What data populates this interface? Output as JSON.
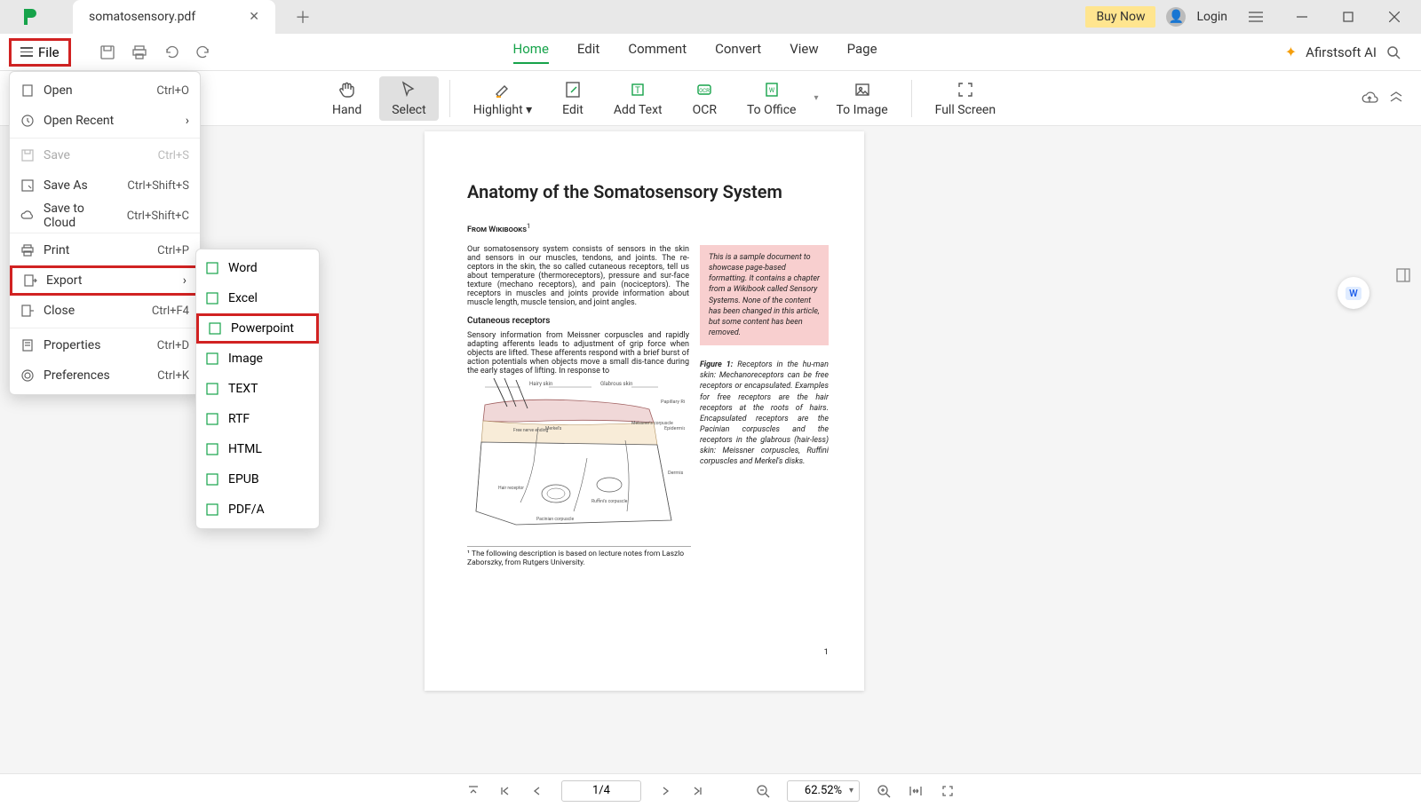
{
  "titlebar": {
    "tab_title": "somatosensory.pdf",
    "buy_now": "Buy Now",
    "login": "Login"
  },
  "menubar": {
    "file": "File",
    "tabs": [
      "Home",
      "Edit",
      "Comment",
      "Convert",
      "View",
      "Page"
    ],
    "ai_label": "Afirstsoft AI"
  },
  "ribbon": {
    "hand": "Hand",
    "select": "Select",
    "highlight": "Highlight",
    "edit": "Edit",
    "addtext": "Add Text",
    "ocr": "OCR",
    "tooffice": "To Office",
    "toimage": "To Image",
    "fullscreen": "Full Screen"
  },
  "file_menu": {
    "open": {
      "label": "Open",
      "sc": "Ctrl+O"
    },
    "open_recent": {
      "label": "Open Recent"
    },
    "save": {
      "label": "Save",
      "sc": "Ctrl+S"
    },
    "save_as": {
      "label": "Save As",
      "sc": "Ctrl+Shift+S"
    },
    "save_cloud": {
      "label": "Save to Cloud",
      "sc": "Ctrl+Shift+C"
    },
    "print": {
      "label": "Print",
      "sc": "Ctrl+P"
    },
    "export": {
      "label": "Export"
    },
    "close": {
      "label": "Close",
      "sc": "Ctrl+F4"
    },
    "properties": {
      "label": "Properties",
      "sc": "Ctrl+D"
    },
    "preferences": {
      "label": "Preferences",
      "sc": "Ctrl+K"
    }
  },
  "export_menu": {
    "word": "Word",
    "excel": "Excel",
    "powerpoint": "Powerpoint",
    "image": "Image",
    "text": "TEXT",
    "rtf": "RTF",
    "html": "HTML",
    "epub": "EPUB",
    "pdfa": "PDF/A"
  },
  "doc": {
    "title": "Anatomy of the Somatosensory System",
    "from": "From Wikibooks",
    "para1": "Our somatosensory system consists of sensors in the skin and sensors in our muscles, tendons, and joints. The re-ceptors in the skin, the so called cutaneous receptors, tell us about temperature (thermoreceptors), pressure and sur-face texture (mechano receptors), and pain (nociceptors). The receptors in muscles and joints provide information about muscle length, muscle tension, and joint angles.",
    "sample": "This is a sample document to showcase page-based formatting. It contains a chapter from a Wikibook called Sensory Systems. None of the content has been changed in this article, but some content has been removed.",
    "sub1": "Cutaneous receptors",
    "para2": "Sensory information from Meissner corpuscles and rapidly adapting afferents leads to adjustment of grip force when objects are lifted. These afferents respond with a brief burst of action potentials when objects move a small dis-tance during the early stages of lifting. In response to",
    "figcap_b": "Figure 1:",
    "figcap": " Receptors in the hu-man skin: Mechanoreceptors can be free receptors or encapsulated. Examples for free receptors are the hair receptors at the roots of hairs. Encapsulated receptors are the Pacinian corpuscles and the receptors in the glabrous (hair-less) skin: Meissner corpuscles, Ruffini corpuscles and Merkel's disks.",
    "footnote": "¹ The following description is based on lecture notes from Laszlo Zaborszky, from Rutgers University.",
    "pagenum": "1",
    "fig_labels": {
      "hairy": "Hairy skin",
      "glabrous": "Glabrous skin",
      "papillary": "Papillary Ridges",
      "epidermis": "Epidermis",
      "dermis": "Dermis",
      "meissner": "Meissner's corpuscle",
      "merkel": "Merkel's disc",
      "freenerve": "Free nerve ending",
      "hairrecep": "Hair receptor",
      "pacinian": "Pacinian corpuscle",
      "ruffini": "Ruffini's corpuscle"
    }
  },
  "status": {
    "page": "1/4",
    "zoom": "62.52%"
  }
}
